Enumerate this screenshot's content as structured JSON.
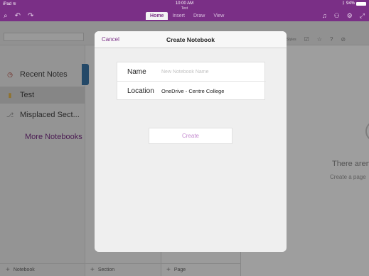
{
  "status": {
    "carrier": "iPad",
    "time": "10:00 AM",
    "doc_title": "Test",
    "battery": "94%"
  },
  "toolbar": {
    "tabs": [
      {
        "label": "Home",
        "active": true
      },
      {
        "label": "Insert",
        "active": false
      },
      {
        "label": "Draw",
        "active": false
      },
      {
        "label": "View",
        "active": false
      }
    ],
    "ribbon_styles": "Styles"
  },
  "notebooks": {
    "items": [
      {
        "label": "Recent Notes",
        "icon": "clock-icon"
      },
      {
        "label": "Test",
        "icon": "notebook-icon"
      },
      {
        "label": "Misplaced Sect...",
        "icon": "section-icon"
      },
      {
        "label": "More Notebooks",
        "icon": ""
      }
    ],
    "add_label": "Notebook"
  },
  "sections": {
    "add_label": "Section"
  },
  "pages": {
    "add_label": "Page"
  },
  "canvas": {
    "title": "There aren",
    "subtitle": "Create a page"
  },
  "modal": {
    "cancel_label": "Cancel",
    "title": "Create Notebook",
    "name_label": "Name",
    "name_placeholder": "New Notebook Name",
    "name_value": "",
    "location_label": "Location",
    "location_value": "OneDrive - Centre College",
    "create_label": "Create"
  },
  "colors": {
    "brand": "#7a2f86",
    "section_tab": "#3a76a8"
  }
}
